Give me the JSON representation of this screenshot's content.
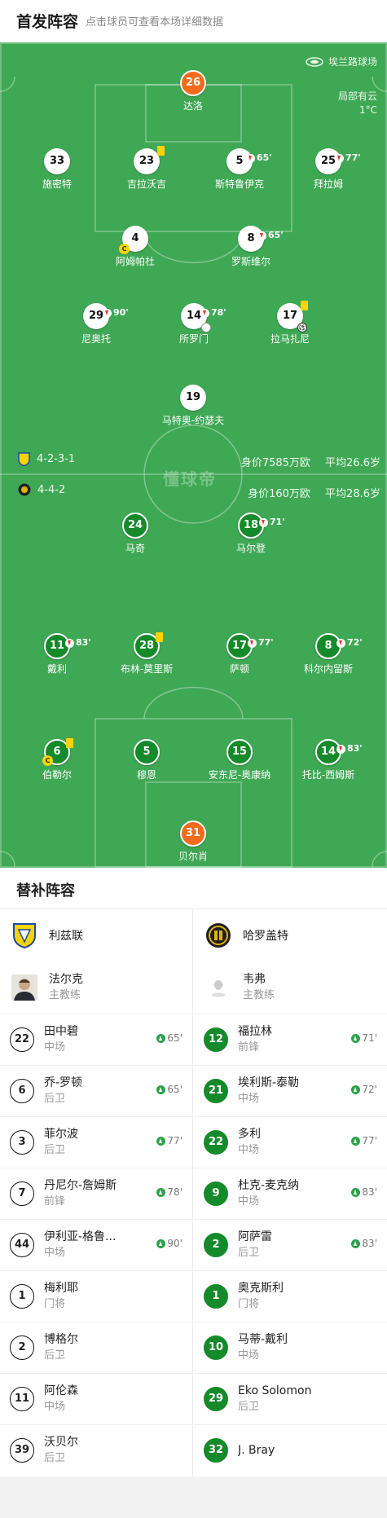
{
  "header": {
    "title": "首发阵容",
    "hint": "点击球员可查看本场详细数据"
  },
  "pitch": {
    "stadium": "埃兰路球场",
    "weather_desc": "局部有云",
    "weather_temp": "1°C",
    "watermark": "懂球帝",
    "colors": {
      "grass": "#3fa854",
      "home_kit": "#ffffff",
      "away_kit": "#158a2a",
      "keeper": "#f26b1d",
      "yellow_card": "#ffd200"
    }
  },
  "home": {
    "formation": "4-2-3-1",
    "value": "身价7585万欧",
    "age": "平均26.6岁",
    "players": [
      {
        "num": "26",
        "name": "达洛"
      },
      {
        "num": "33",
        "name": "施密特"
      },
      {
        "num": "23",
        "name": "吉拉沃吉"
      },
      {
        "num": "5",
        "name": "斯特鲁伊克",
        "out": "65'"
      },
      {
        "num": "25",
        "name": "拜拉姆",
        "out": "77'"
      },
      {
        "num": "4",
        "name": "阿姆帕杜"
      },
      {
        "num": "8",
        "name": "罗斯维尔",
        "out": "65'"
      },
      {
        "num": "29",
        "name": "尼奥托",
        "out": "90'"
      },
      {
        "num": "14",
        "name": "所罗门",
        "out": "78'"
      },
      {
        "num": "17",
        "name": "拉马扎尼"
      },
      {
        "num": "19",
        "name": "马特奥-约瑟夫"
      }
    ]
  },
  "away": {
    "formation": "4-4-2",
    "value": "身价160万欧",
    "age": "平均28.6岁",
    "players": [
      {
        "num": "24",
        "name": "马奇"
      },
      {
        "num": "18",
        "name": "马尔登",
        "out": "71'"
      },
      {
        "num": "11",
        "name": "戴利",
        "out": "83'"
      },
      {
        "num": "28",
        "name": "布林-莫里斯"
      },
      {
        "num": "17",
        "name": "萨顿",
        "out": "77'"
      },
      {
        "num": "8",
        "name": "科尔内留斯",
        "out": "72'"
      },
      {
        "num": "6",
        "name": "伯勒尔"
      },
      {
        "num": "5",
        "name": "穆恩"
      },
      {
        "num": "15",
        "name": "安东尼-奥康纳"
      },
      {
        "num": "14",
        "name": "托比-西姆斯",
        "out": "83'"
      },
      {
        "num": "31",
        "name": "贝尔肖"
      }
    ]
  },
  "subs": {
    "title": "替补阵容",
    "home": {
      "team": "利兹联",
      "coach_name": "法尔克",
      "coach_role": "主教练",
      "players": [
        {
          "num": "22",
          "name": "田中碧",
          "pos": "中场",
          "in": "65'"
        },
        {
          "num": "6",
          "name": "乔-罗顿",
          "pos": "后卫",
          "in": "65'"
        },
        {
          "num": "3",
          "name": "菲尔波",
          "pos": "后卫",
          "in": "77'"
        },
        {
          "num": "7",
          "name": "丹尼尔-詹姆斯",
          "pos": "前锋",
          "in": "78'"
        },
        {
          "num": "44",
          "name": "伊利亚-格鲁...",
          "pos": "中场",
          "in": "90'"
        },
        {
          "num": "1",
          "name": "梅利耶",
          "pos": "门将"
        },
        {
          "num": "2",
          "name": "博格尔",
          "pos": "后卫"
        },
        {
          "num": "11",
          "name": "阿伦森",
          "pos": "中场"
        },
        {
          "num": "39",
          "name": "沃贝尔",
          "pos": "后卫"
        }
      ]
    },
    "away": {
      "team": "哈罗盖特",
      "coach_name": "韦弗",
      "coach_role": "主教练",
      "players": [
        {
          "num": "12",
          "name": "福拉林",
          "pos": "前锋",
          "in": "71'"
        },
        {
          "num": "21",
          "name": "埃利斯-泰勒",
          "pos": "中场",
          "in": "72'"
        },
        {
          "num": "22",
          "name": "多利",
          "pos": "中场",
          "in": "77'"
        },
        {
          "num": "9",
          "name": "杜克-麦克纳",
          "pos": "中场",
          "in": "83'"
        },
        {
          "num": "2",
          "name": "阿萨雷",
          "pos": "后卫",
          "in": "83'"
        },
        {
          "num": "1",
          "name": "奥克斯利",
          "pos": "门将"
        },
        {
          "num": "10",
          "name": "马蒂-戴利",
          "pos": "中场"
        },
        {
          "num": "29",
          "name": "Eko Solomon",
          "pos": "后卫"
        },
        {
          "num": "32",
          "name": "J. Bray",
          "pos": ""
        }
      ]
    }
  }
}
